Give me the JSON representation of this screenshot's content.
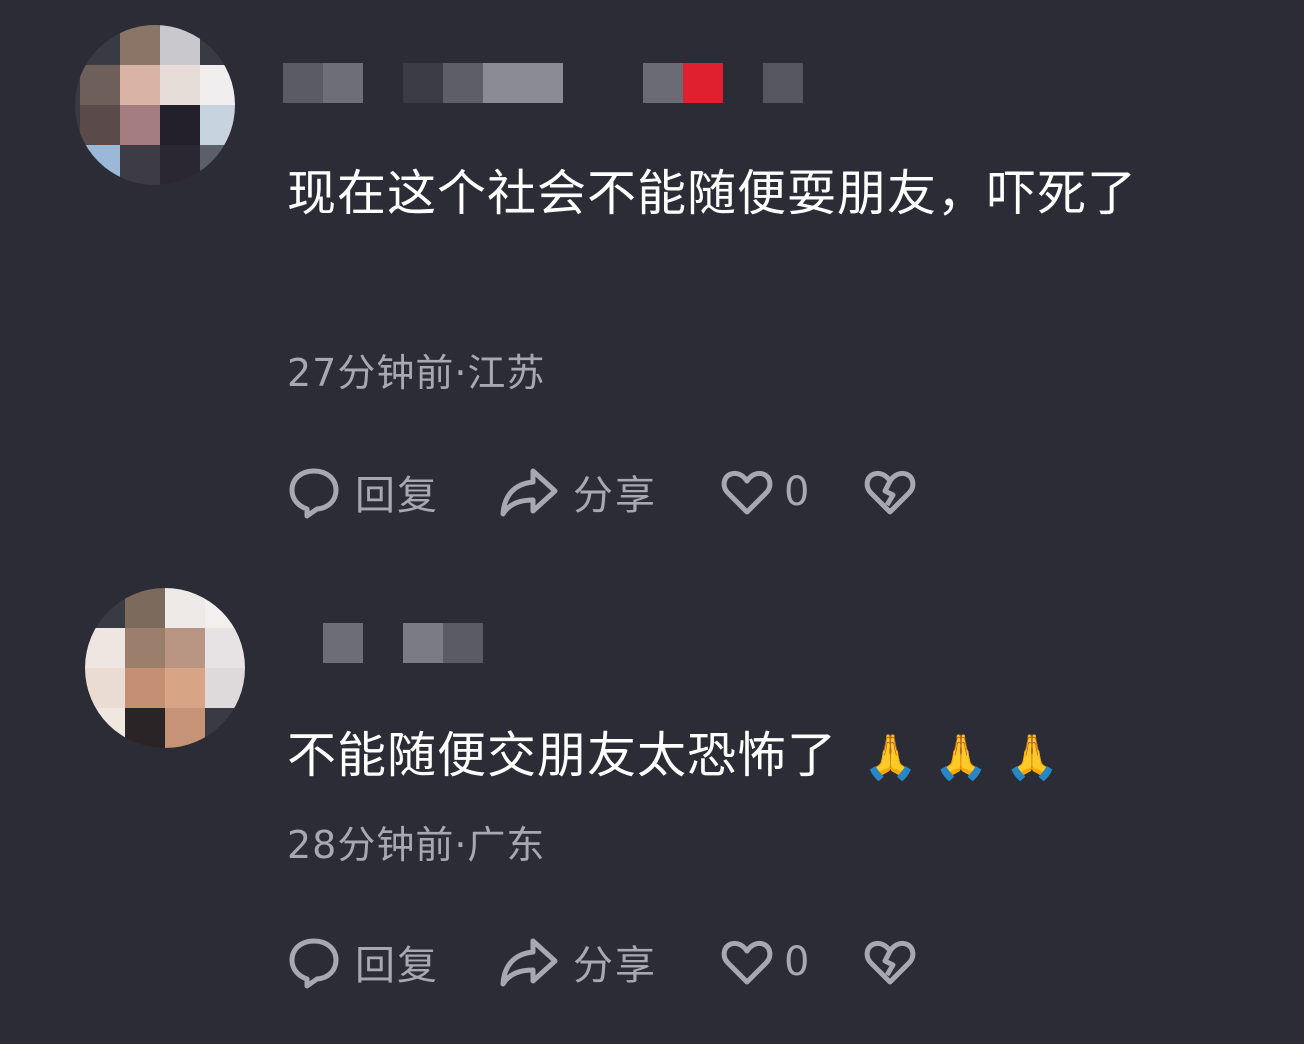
{
  "comments": [
    {
      "text": "现在这个社会不能随便耍朋友，吓死了",
      "emoji": "",
      "meta": "27分钟前·江苏",
      "actions": {
        "reply_label": "回复",
        "share_label": "分享",
        "like_count": "0"
      }
    },
    {
      "text": "不能随便交朋友太恐怖了",
      "emoji": "🙏 🙏 🙏",
      "meta": "28分钟前·广东",
      "actions": {
        "reply_label": "回复",
        "share_label": "分享",
        "like_count": "0"
      }
    }
  ],
  "icons": {
    "reply": "speech-bubble-icon",
    "share": "share-arrow-icon",
    "like": "heart-icon",
    "dislike": "broken-heart-icon"
  },
  "colors": {
    "background": "#2b2c36",
    "text_primary": "#ffffff",
    "text_secondary": "#a7a8b0",
    "icon": "#a7a8b0",
    "name_badge_red": "#e0202e"
  }
}
